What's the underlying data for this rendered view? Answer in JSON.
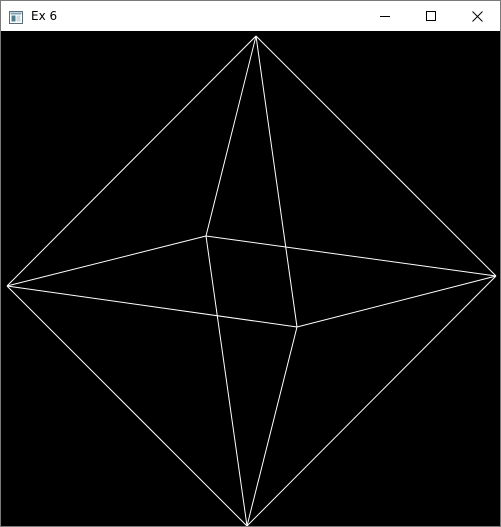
{
  "window": {
    "title": "Ex 6",
    "background_color": "#000000",
    "line_color": "#ffffff",
    "icons": {
      "app": "app-window-icon",
      "minimize": "minimize-icon",
      "maximize": "maximize-icon",
      "close": "close-icon"
    }
  }
}
